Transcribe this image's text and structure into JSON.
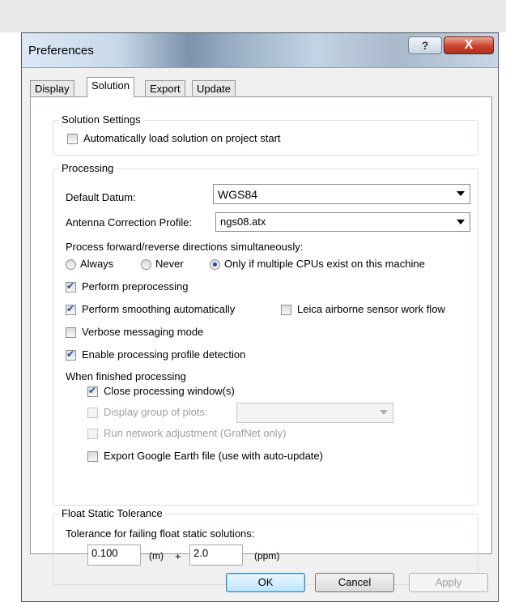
{
  "window": {
    "title": "Preferences",
    "help_label": "?",
    "close_label": "X"
  },
  "tabs": [
    {
      "label": "Display",
      "active": false
    },
    {
      "label": "Solution",
      "active": true
    },
    {
      "label": "Export",
      "active": false
    },
    {
      "label": "Update",
      "active": false
    }
  ],
  "solution_settings": {
    "legend": "Solution Settings",
    "auto_load": {
      "label": "Automatically load solution on project start",
      "checked": false
    }
  },
  "processing": {
    "legend": "Processing",
    "datum": {
      "label": "Default Datum:",
      "value": "WGS84"
    },
    "antenna": {
      "label": "Antenna Correction Profile:",
      "value": "ngs08.atx"
    },
    "direction": {
      "label": "Process forward/reverse directions simultaneously:",
      "options": [
        "Always",
        "Never",
        "Only if multiple CPUs exist on this machine"
      ],
      "selected": "Only if multiple CPUs exist on this machine"
    },
    "preprocessing": {
      "label": "Perform preprocessing",
      "checked": true
    },
    "smoothing": {
      "label": "Perform smoothing automatically",
      "checked": true
    },
    "leica": {
      "label": "Leica airborne sensor work flow",
      "checked": false
    },
    "verbose": {
      "label": "Verbose messaging mode",
      "checked": false
    },
    "profile_detection": {
      "label": "Enable processing profile detection",
      "checked": true
    },
    "when_finished": {
      "label": "When finished processing",
      "close_windows": {
        "label": "Close processing window(s)",
        "checked": true
      },
      "display_plots": {
        "label": "Display group of plots:",
        "checked": false,
        "disabled": true,
        "value": ""
      },
      "network_adjust": {
        "label": "Run network adjustment (GrafNet only)",
        "checked": false,
        "disabled": true
      },
      "google_earth": {
        "label": "Export Google Earth file (use with auto-update)",
        "checked": false
      }
    }
  },
  "float_static": {
    "legend": "Float Static Tolerance",
    "label": "Tolerance for failing float static solutions:",
    "value_m": "0.100",
    "unit_m": "(m)",
    "plus": "+",
    "value_ppm": "2.0",
    "unit_ppm": "(ppm)"
  },
  "buttons": {
    "ok": "OK",
    "cancel": "Cancel",
    "apply": "Apply"
  }
}
